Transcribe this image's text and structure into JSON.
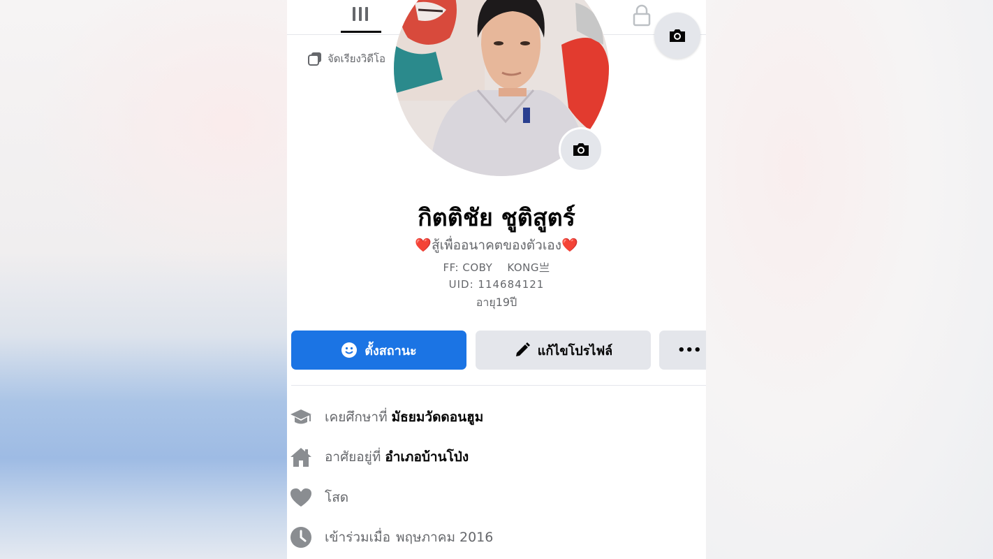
{
  "profile": {
    "name": "กิตติชัย ชูติสูตร์",
    "bio": {
      "heart_left": "❤️",
      "tagline": "สู้เพื่ออนาคตของตัวเอง",
      "heart_right": "❤️",
      "ff": "FF: COBY    KONG亗",
      "uid": "UID: 114684121",
      "age": "อายุ19ปี"
    }
  },
  "album_label": "จัดเรียงวิดีโอ",
  "tabs": {
    "grid_icon": "grid-icon",
    "lock_icon": "lock-icon"
  },
  "actions": {
    "primary": {
      "label": "ตั้งสถานะ",
      "icon": "smiley-icon"
    },
    "edit": {
      "label": "แก้ไขโปรไฟล์",
      "icon": "pencil-icon"
    },
    "more": {
      "label": "•••"
    }
  },
  "info": [
    {
      "icon": "graduation-cap-icon",
      "prefix": "เคยศึกษาที่",
      "value": "มัธยมวัดดอนฮูม"
    },
    {
      "icon": "home-icon",
      "prefix": "อาศัยอยู่ที่",
      "value": "อำเภอบ้านโป่ง"
    },
    {
      "icon": "heart-icon",
      "prefix": "โสด",
      "value": ""
    },
    {
      "icon": "clock-icon",
      "prefix": "เข้าร่วมเมื่อ",
      "value": "พฤษภาคม 2016"
    }
  ],
  "colors": {
    "accent": "#1b74e4",
    "secondary_button": "#e4e6eb",
    "muted_text": "#65676b",
    "heart": "#e41e3f"
  }
}
